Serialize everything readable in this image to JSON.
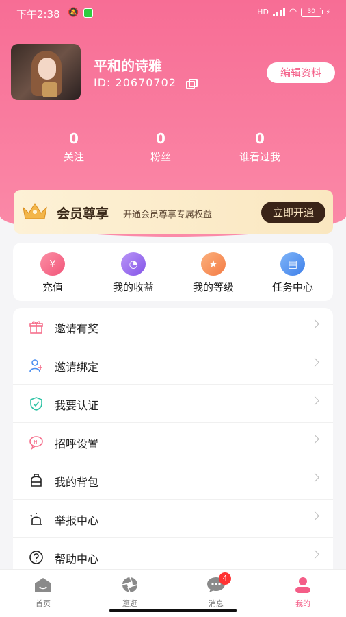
{
  "status_bar": {
    "time": "下午2:38",
    "network": "HD",
    "battery": "30"
  },
  "profile": {
    "name": "平和的诗雅",
    "id_label": "ID:",
    "id_value": "20670702",
    "edit_button": "编辑资料"
  },
  "stats": [
    {
      "value": "0",
      "label": "关注"
    },
    {
      "value": "0",
      "label": "粉丝"
    },
    {
      "value": "0",
      "label": "谁看过我"
    }
  ],
  "vip": {
    "title": "会员尊享",
    "subtitle": "开通会员尊享专属权益",
    "button": "立即开通"
  },
  "quick_actions": [
    {
      "label": "充值",
      "icon": "yuan-icon",
      "color": "#f76584"
    },
    {
      "label": "我的收益",
      "icon": "income-icon",
      "color": "#9b6cf0"
    },
    {
      "label": "我的等级",
      "icon": "level-icon",
      "color": "#f7925a"
    },
    {
      "label": "任务中心",
      "icon": "task-icon",
      "color": "#4a8ef0"
    }
  ],
  "menu": [
    {
      "label": "邀请有奖",
      "icon": "gift-icon"
    },
    {
      "label": "邀请绑定",
      "icon": "add-user-icon"
    },
    {
      "label": "我要认证",
      "icon": "shield-check-icon"
    },
    {
      "label": "招呼设置",
      "icon": "hi-bubble-icon"
    },
    {
      "label": "我的背包",
      "icon": "backpack-icon"
    },
    {
      "label": "举报中心",
      "icon": "alarm-icon"
    },
    {
      "label": "帮助中心",
      "icon": "help-icon"
    }
  ],
  "bottom_nav": [
    {
      "label": "首页",
      "icon": "home-icon"
    },
    {
      "label": "逛逛",
      "icon": "aperture-icon"
    },
    {
      "label": "消息",
      "icon": "message-icon",
      "badge": "4"
    },
    {
      "label": "我的",
      "icon": "profile-icon",
      "active": true
    }
  ],
  "colors": {
    "brand": "#f76d95",
    "active_tab": "#f45d87",
    "vip_button": "#3a2418"
  }
}
